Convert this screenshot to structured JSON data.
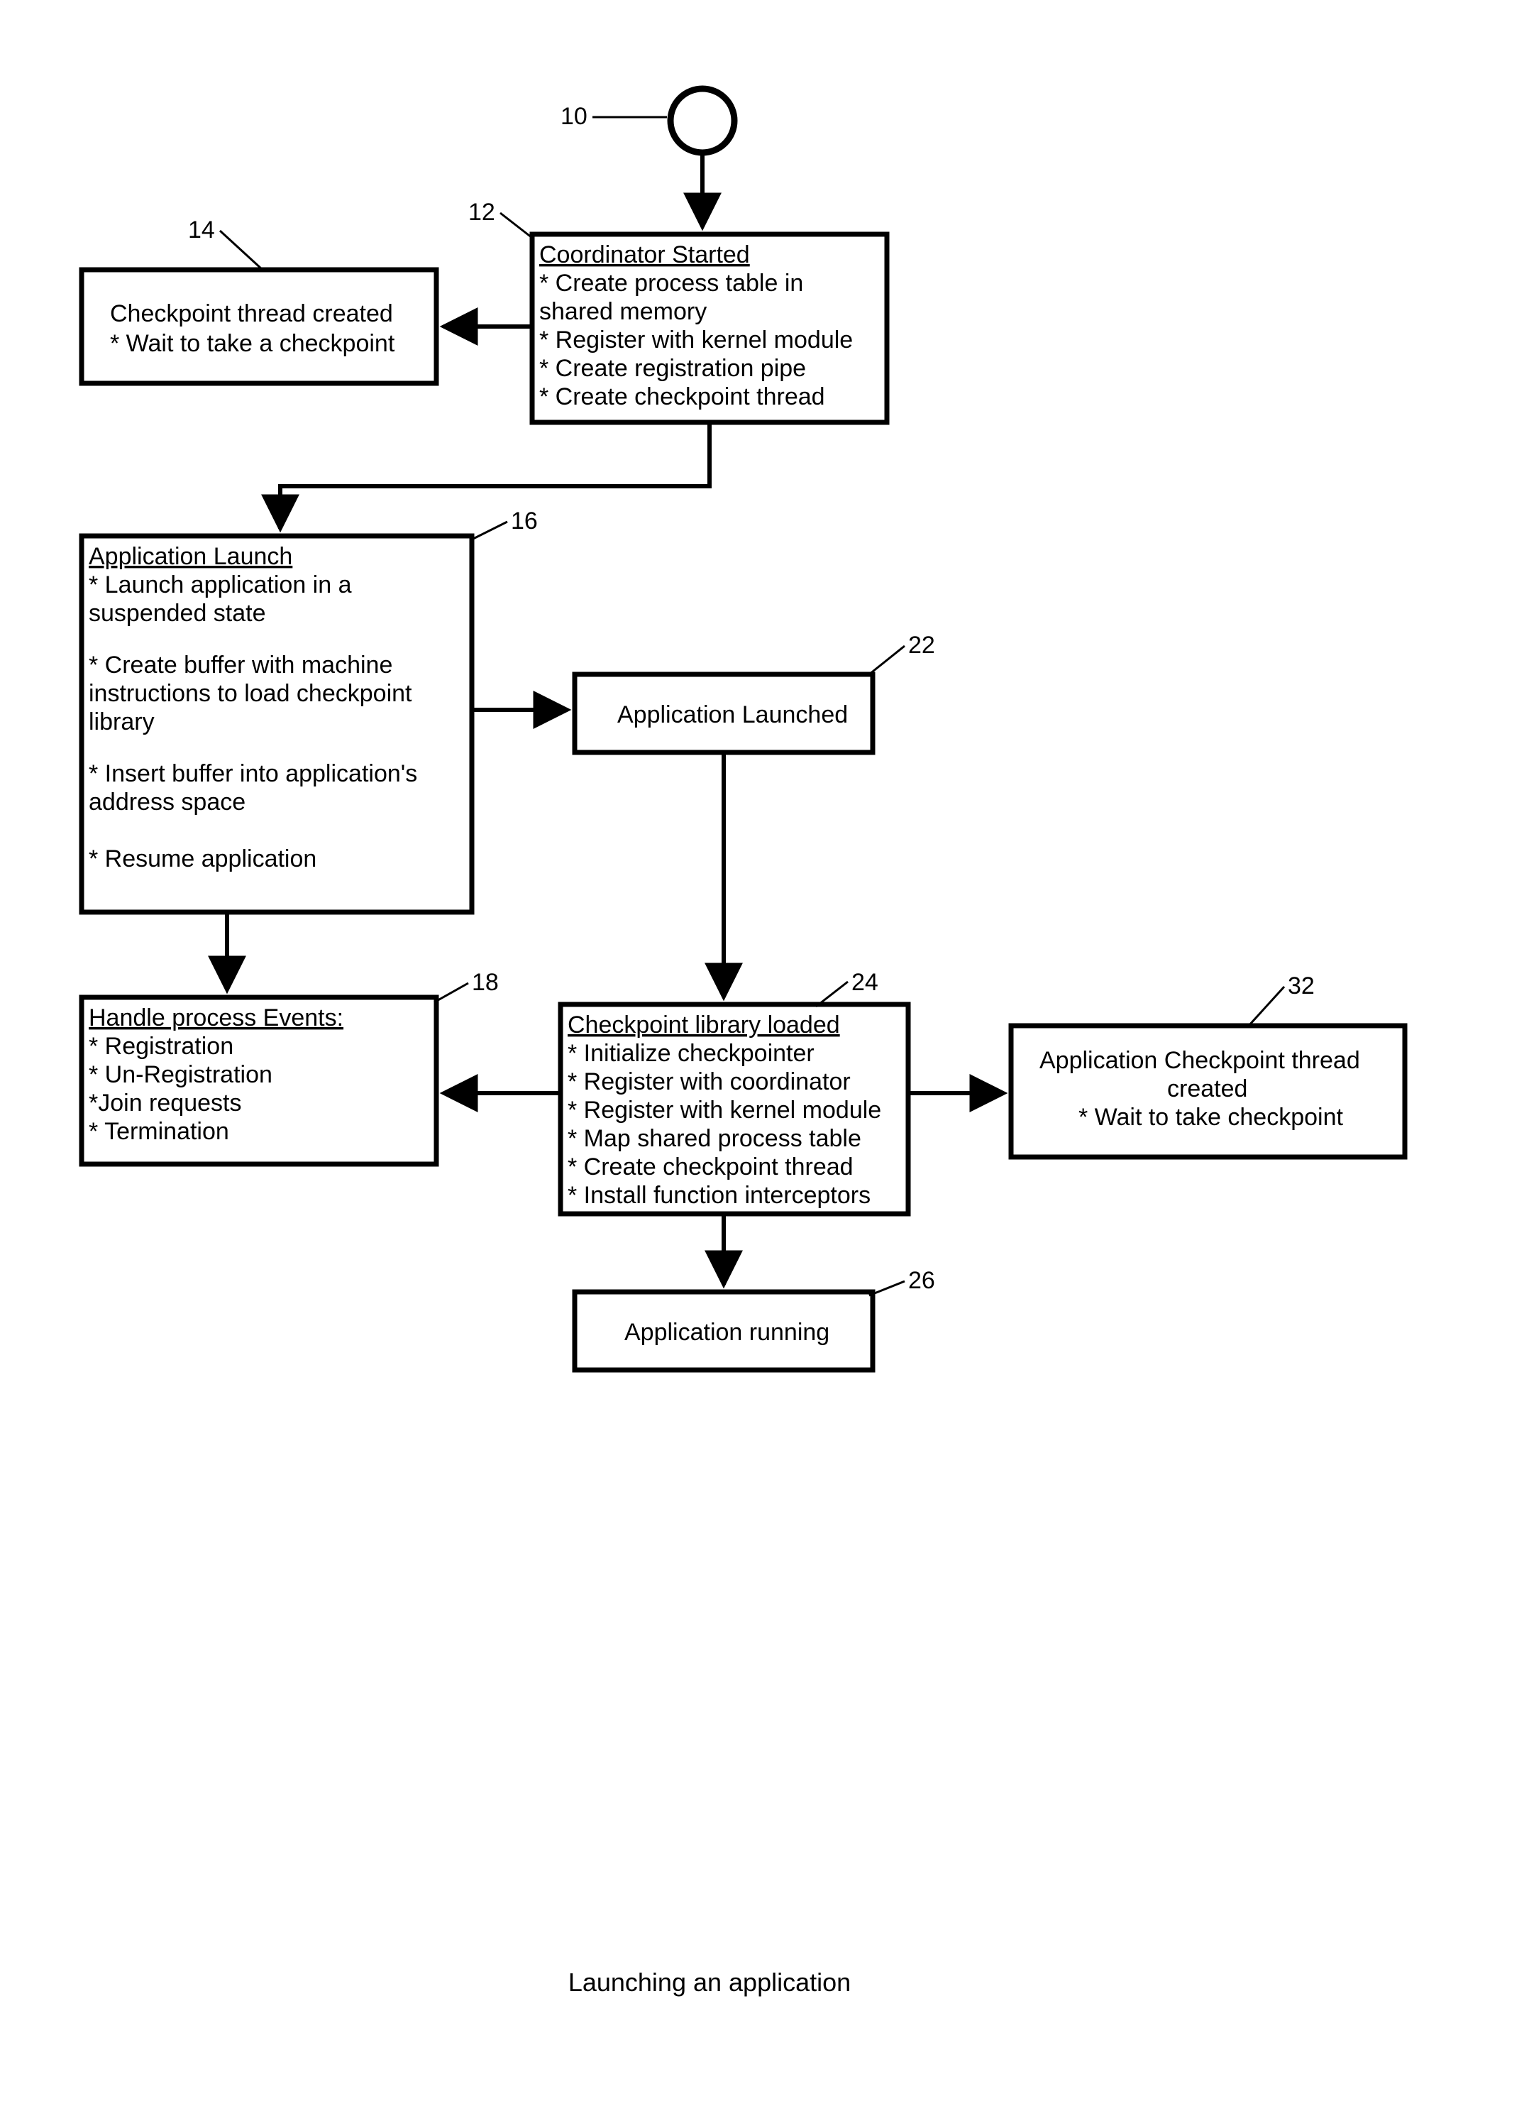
{
  "caption": "Launching an application",
  "refs": {
    "r10": "10",
    "r12": "12",
    "r14": "14",
    "r16": "16",
    "r18": "18",
    "r22": "22",
    "r24": "24",
    "r26": "26",
    "r32": "32"
  },
  "boxes": {
    "b12": {
      "title": "Coordinator Started",
      "lines": [
        "* Create process table in",
        "shared memory",
        "* Register with kernel module",
        "* Create registration pipe",
        "* Create checkpoint thread"
      ]
    },
    "b14": {
      "lines": [
        "Checkpoint thread created",
        "* Wait to take a checkpoint"
      ]
    },
    "b16": {
      "title": "Application Launch",
      "lines": [
        "* Launch application in a",
        "suspended state",
        "",
        "* Create buffer with machine",
        "instructions to load checkpoint",
        "library",
        "",
        "* Insert buffer into application's",
        "address space",
        "",
        "* Resume application"
      ]
    },
    "b18": {
      "title": "Handle process Events:",
      "lines": [
        "* Registration",
        "* Un-Registration",
        "*Join requests",
        "* Termination"
      ]
    },
    "b22": {
      "lines": [
        "Application Launched"
      ]
    },
    "b24": {
      "title": "Checkpoint library loaded",
      "lines": [
        "* Initialize checkpointer",
        "* Register with coordinator",
        "* Register with kernel module",
        "* Map shared process table",
        "* Create checkpoint thread",
        "* Install function interceptors"
      ]
    },
    "b26": {
      "lines": [
        "Application running"
      ]
    },
    "b32": {
      "lines": [
        "Application Checkpoint thread",
        "created",
        "* Wait to take checkpoint"
      ]
    }
  }
}
